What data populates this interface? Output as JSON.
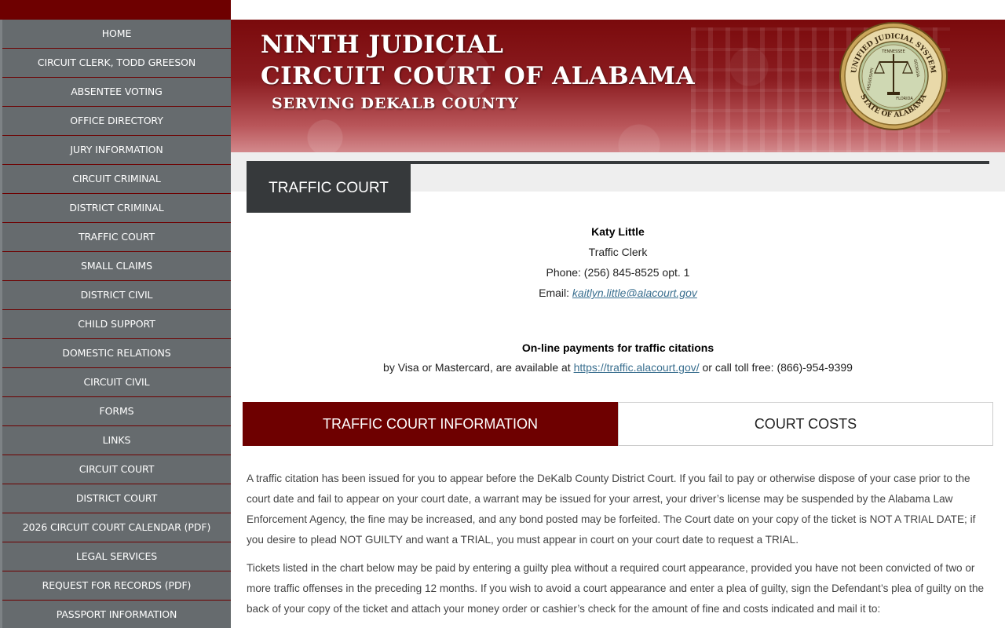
{
  "colors": {
    "brand_maroon": "#6e0000",
    "sidebar_gray": "#666b6e",
    "title_dark": "#36393b",
    "link_blue": "#3a6f8f"
  },
  "sidebar": {
    "items": [
      {
        "label": "HOME"
      },
      {
        "label": "CIRCUIT CLERK, TODD GREESON"
      },
      {
        "label": "ABSENTEE VOTING"
      },
      {
        "label": "OFFICE DIRECTORY"
      },
      {
        "label": "JURY INFORMATION"
      },
      {
        "label": "CIRCUIT CRIMINAL"
      },
      {
        "label": "DISTRICT CRIMINAL"
      },
      {
        "label": "TRAFFIC COURT"
      },
      {
        "label": "SMALL CLAIMS"
      },
      {
        "label": "DISTRICT CIVIL"
      },
      {
        "label": "CHILD SUPPORT"
      },
      {
        "label": "DOMESTIC RELATIONS"
      },
      {
        "label": "CIRCUIT CIVIL"
      },
      {
        "label": "FORMS"
      },
      {
        "label": "LINKS"
      },
      {
        "label": "CIRCUIT COURT"
      },
      {
        "label": "DISTRICT COURT"
      },
      {
        "label": "2026 CIRCUIT COURT CALENDAR (PDF)"
      },
      {
        "label": "LEGAL SERVICES"
      },
      {
        "label": "REQUEST FOR RECORDS (PDF)"
      },
      {
        "label": "PASSPORT INFORMATION"
      }
    ]
  },
  "banner": {
    "line1": "NINTH  JUDICIAL",
    "line2": "CIRCUIT COURT OF ALABAMA",
    "subtitle": "SERVING DEKALB COUNTY",
    "seal": {
      "ring_top": "UNIFIED JUDICIAL SYSTEM",
      "ring_bottom": "STATE OF ALABAMA",
      "states": [
        "TENNESSEE",
        "GEORGIA",
        "MISSISSIPPI",
        "FLORIDA"
      ]
    }
  },
  "main": {
    "page_title": "TRAFFIC COURT",
    "clerk": {
      "name": "Katy Little",
      "role": "Traffic Clerk",
      "phone": "Phone: (256) 845-8525 opt. 1",
      "email_label": "Email: ",
      "email": "kaitlyn.little@alacourt.gov"
    },
    "payments": {
      "heading": "On-line payments for traffic citations",
      "text_before": "by Visa or Mastercard, are available at ",
      "link": "https://traffic.alacourt.gov/",
      "text_after": " or call toll free: (866)-954-9399"
    },
    "tabs": [
      {
        "label": "TRAFFIC COURT INFORMATION",
        "active": true
      },
      {
        "label": "COURT COSTS",
        "active": false
      }
    ],
    "paragraphs": [
      "A traffic citation has been issued for you to appear before the DeKalb County District Court. If you fail to pay or otherwise dispose of your case prior to the court date and fail to appear on your court date, a warrant may be issued for your arrest, your driver’s license may be suspended by the Alabama Law Enforcement Agency, the fine may be increased, and any bond posted may be forfeited. The Court date on your copy of the ticket is NOT A TRIAL DATE; if you desire to plead NOT GUILTY and want a TRIAL, you must appear in court on your court date to request a TRIAL.",
      "Tickets listed in the chart below may be paid by entering a guilty plea without a required court appearance, provided you have not been convicted of two or more traffic offenses in the preceding 12 months. If you wish to avoid a court appearance and enter a plea of guilty, sign the Defendant’s plea of guilty on the back of your copy of the ticket and attach your money order or cashier’s check for the amount of fine and costs indicated and mail it to:"
    ]
  }
}
